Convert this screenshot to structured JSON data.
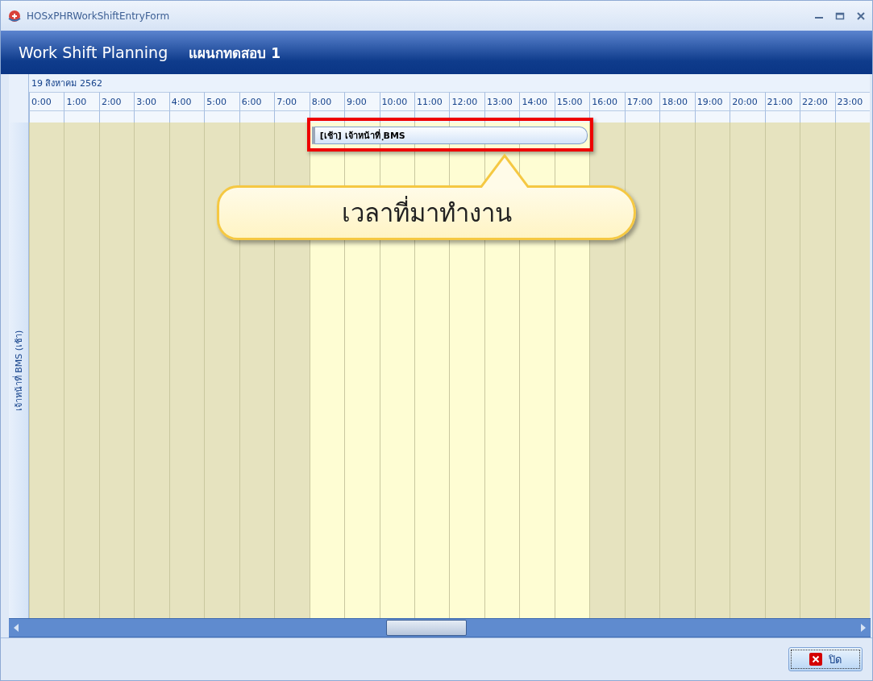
{
  "window": {
    "title": "HOSxPHRWorkShiftEntryForm"
  },
  "header": {
    "title": "Work Shift Planning",
    "department": "แผนกทดสอบ 1"
  },
  "schedule": {
    "date": "19 สิงหาคม 2562",
    "resource": "เจ้าหน้าที่ BMS (เช้า)",
    "hours": [
      {
        "label": "0:00",
        "working": false
      },
      {
        "label": "1:00",
        "working": false
      },
      {
        "label": "2:00",
        "working": false
      },
      {
        "label": "3:00",
        "working": false
      },
      {
        "label": "4:00",
        "working": false
      },
      {
        "label": "5:00",
        "working": false
      },
      {
        "label": "6:00",
        "working": false
      },
      {
        "label": "7:00",
        "working": false
      },
      {
        "label": "8:00",
        "working": true
      },
      {
        "label": "9:00",
        "working": true
      },
      {
        "label": "10:00",
        "working": true
      },
      {
        "label": "11:00",
        "working": true
      },
      {
        "label": "12:00",
        "working": true
      },
      {
        "label": "13:00",
        "working": true
      },
      {
        "label": "14:00",
        "working": true
      },
      {
        "label": "15:00",
        "working": true
      },
      {
        "label": "16:00",
        "working": false
      },
      {
        "label": "17:00",
        "working": false
      },
      {
        "label": "18:00",
        "working": false
      },
      {
        "label": "19:00",
        "working": false
      },
      {
        "label": "20:00",
        "working": false
      },
      {
        "label": "21:00",
        "working": false
      },
      {
        "label": "22:00",
        "working": false
      },
      {
        "label": "23:00",
        "working": false
      }
    ],
    "appointment": {
      "text": "[เช้า] เจ้าหน้าที่ ฺBMS"
    },
    "callout": {
      "text": "เวลาที่มาทำงาน"
    }
  },
  "buttons": [
    {
      "label": "ปิด"
    }
  ]
}
